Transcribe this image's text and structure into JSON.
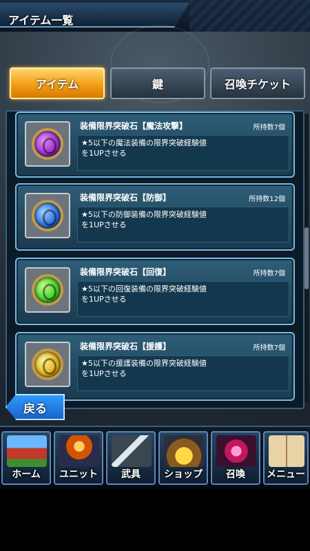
{
  "header": {
    "title": "アイテム一覧"
  },
  "tabs": [
    {
      "label": "アイテム",
      "active": true
    },
    {
      "label": "鍵",
      "active": false
    },
    {
      "label": "召喚チケット",
      "active": false
    }
  ],
  "items": [
    {
      "name": "装備限界突破石【魔法攻撃】",
      "count": "所持数7個",
      "desc_line1": "★5以下の魔法装備の限界突破経験値",
      "desc_line2": "を1UPさせる",
      "gem_color": "#9a2fc8",
      "icon": "purple-gem-icon"
    },
    {
      "name": "装備限界突破石【防御】",
      "count": "所持数12個",
      "desc_line1": "★5以下の防御装備の限界突破経験値",
      "desc_line2": "を1UPさせる",
      "gem_color": "#2a6ce0",
      "icon": "blue-gem-icon"
    },
    {
      "name": "装備限界突破石【回復】",
      "count": "所持数7個",
      "desc_line1": "★5以下の回復装備の限界突破経験値",
      "desc_line2": "を1UPさせる",
      "gem_color": "#3ecb2a",
      "icon": "green-gem-icon"
    },
    {
      "name": "装備限界突破石【援護】",
      "count": "所持数7個",
      "desc_line1": "★5以下の援護装備の限界突破経験値",
      "desc_line2": "を1UPさせる",
      "gem_color": "#e2b21a",
      "icon": "yellow-gem-icon"
    }
  ],
  "back_button": {
    "label": "戻る"
  },
  "nav": [
    {
      "label": "ホーム",
      "icon": "home-icon",
      "color": "#c0392b"
    },
    {
      "label": "ユニット",
      "icon": "unit-icon",
      "color": "#d35400"
    },
    {
      "label": "武具",
      "icon": "weapon-icon",
      "color": "#7f8c8d"
    },
    {
      "label": "ショップ",
      "icon": "shop-icon",
      "color": "#b8860b"
    },
    {
      "label": "召喚",
      "icon": "summon-icon",
      "color": "#c2185b"
    },
    {
      "label": "メニュー",
      "icon": "menu-icon",
      "color": "#a67c52"
    }
  ]
}
